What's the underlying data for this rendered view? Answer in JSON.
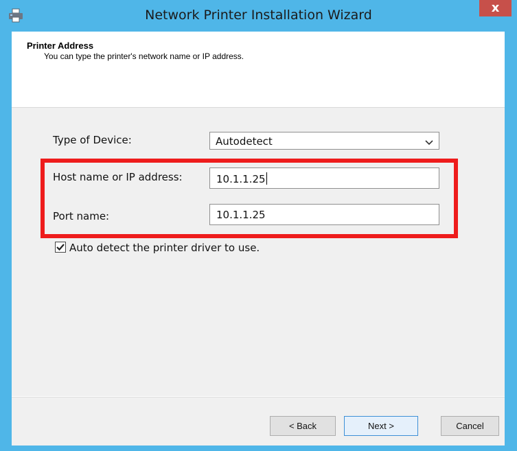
{
  "window": {
    "title": "Network Printer Installation Wizard",
    "close_glyph": "x",
    "icon": "printer-icon",
    "accent": "#4fb6e8",
    "close_color": "#c7504a"
  },
  "header": {
    "title": "Printer Address",
    "subtitle": "You can type the printer's network name or IP address."
  },
  "form": {
    "device_type_label": "Type of Device:",
    "device_type_value": "Autodetect",
    "host_label": "Host name or IP address:",
    "host_value": "10.1.1.25",
    "port_label": "Port name:",
    "port_value": "10.1.1.25",
    "auto_detect_label": "Auto detect the printer driver to use.",
    "auto_detect_checked": true,
    "highlight_color": "#ee1c1c"
  },
  "buttons": {
    "back": "< Back",
    "next": "Next >",
    "cancel": "Cancel"
  }
}
